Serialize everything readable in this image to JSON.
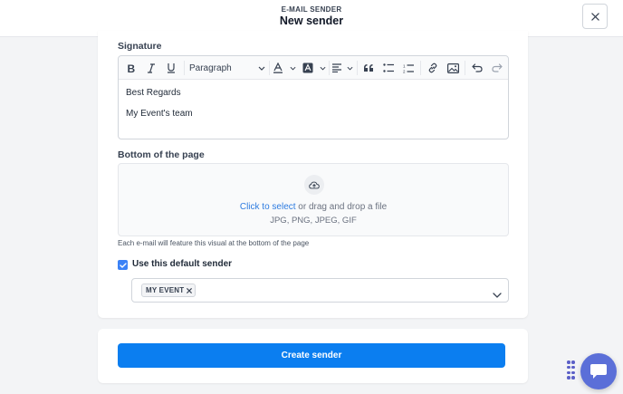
{
  "header": {
    "eyebrow": "E-MAIL SENDER",
    "title": "New sender"
  },
  "signature": {
    "label": "Signature",
    "toolbar": {
      "paragraph_style": "Paragraph"
    },
    "content": [
      "Best Regards",
      "My Event's team"
    ]
  },
  "bottom_of_page": {
    "label": "Bottom of the page",
    "link_text": "Click to select",
    "rest_text": " or drag and drop a file",
    "formats": "JPG, PNG, JPEG, GIF",
    "help": "Each e-mail will feature this visual at the bottom of the page"
  },
  "default_sender": {
    "checked": true,
    "label": "Use this default sender",
    "selected_chip": "MY EVENT"
  },
  "actions": {
    "create_label": "Create sender"
  },
  "colors": {
    "primary": "#0b7ef0",
    "link": "#2d7be0",
    "checkbox": "#3b82f6",
    "chat": "#5b6fd8"
  }
}
